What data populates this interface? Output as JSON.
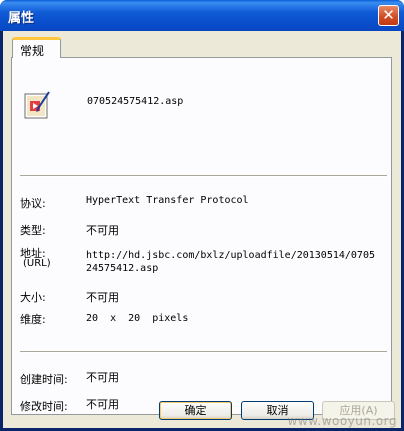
{
  "window": {
    "title": "属性"
  },
  "tabs": [
    {
      "label": "常规"
    }
  ],
  "file": {
    "name": "070524575412.asp"
  },
  "properties": {
    "protocol_label": "协议:",
    "protocol_value": "HyperText Transfer Protocol",
    "type_label": "类型:",
    "type_value": "不可用",
    "address_label": "地址:",
    "address_sublabel": "(URL)",
    "address_value": "http://hd.jsbc.com/bxlz/uploadfile/20130514/070524575412.asp",
    "size_label": "大小:",
    "size_value": "不可用",
    "dimensions_label": "维度:",
    "dimensions_value": "20  x  20  pixels",
    "created_label": "创建时间:",
    "created_value": "不可用",
    "modified_label": "修改时间:",
    "modified_value": "不可用"
  },
  "buttons": {
    "ok": "确定",
    "cancel": "取消",
    "apply": "应用(A)"
  },
  "watermark": "www.wooyun.org",
  "colors": {
    "title_bar": "#0a4fcc",
    "client_bg": "#ece9d8",
    "tab_accent": "#ffc83c",
    "close_btn": "#d04a22"
  }
}
